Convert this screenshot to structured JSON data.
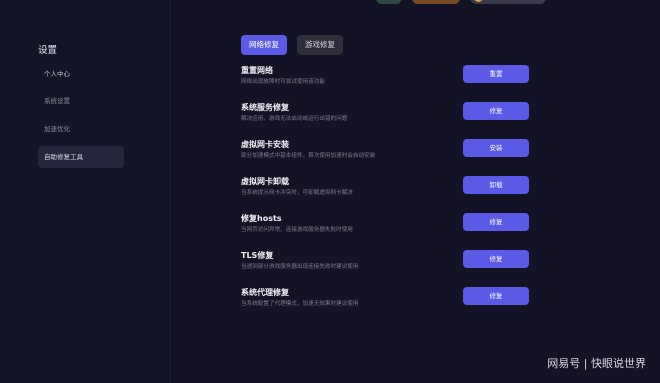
{
  "sidebar": {
    "title": "设置",
    "items": [
      {
        "label": "个人中心"
      },
      {
        "label": "系统设置"
      },
      {
        "label": "加速优化"
      },
      {
        "label": "自助修复工具"
      }
    ]
  },
  "tabs": [
    {
      "label": "网络修复",
      "active": true
    },
    {
      "label": "游戏修复",
      "active": false
    }
  ],
  "repairs": [
    {
      "title": "重置网络",
      "desc": "网络出现故障时可尝试使用该功能",
      "button": "重置"
    },
    {
      "title": "系统服务修复",
      "desc": "解决应用、游戏无法启动或运行出错的问题",
      "button": "修复"
    },
    {
      "title": "虚拟网卡安装",
      "desc": "部分加速模式中基本组件，首次使用加速时会自动安装",
      "button": "安装"
    },
    {
      "title": "虚拟网卡卸载",
      "desc": "当系统提示网卡冲突时，可卸载虚拟网卡解决",
      "button": "卸载"
    },
    {
      "title": "修复hosts",
      "desc": "当网页访问异常、连接游戏服务器失败时使用",
      "button": "修复"
    },
    {
      "title": "TLS修复",
      "desc": "当遇到部分游戏服务器出现连接失败时建议使用",
      "button": "修复"
    },
    {
      "title": "系统代理修复",
      "desc": "当系统配置了代理模式，加速无效果时建议使用",
      "button": "修复"
    }
  ],
  "watermark": "网易号 | 快眼说世界",
  "colors": {
    "accent": "#5a5ae6",
    "background": "#131325"
  }
}
